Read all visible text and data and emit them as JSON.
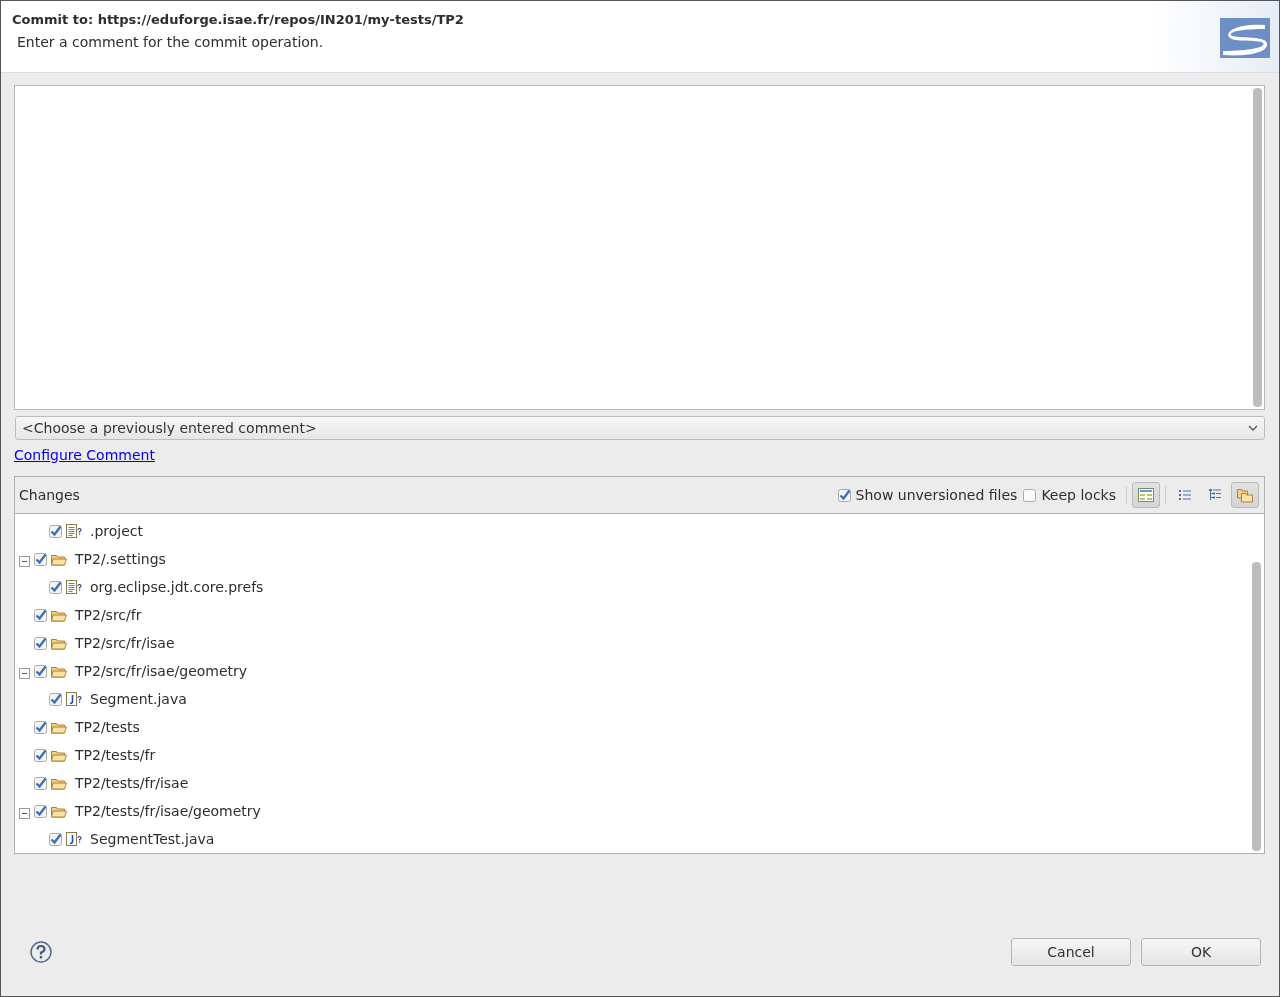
{
  "header": {
    "title": "Commit to: https://eduforge.isae.fr/repos/IN201/my-tests/TP2",
    "message": "Enter a comment for the commit operation."
  },
  "previous_comments": {
    "placeholder": "<Choose a previously entered comment>"
  },
  "configure_link": "Configure Comment",
  "changes": {
    "title": "Changes",
    "options": [
      {
        "label": "Show unversioned files",
        "checked": true
      },
      {
        "label": "Keep locks",
        "checked": false
      }
    ],
    "toolbar": [
      {
        "kind": "layout",
        "selected": true
      },
      {
        "kind": "flat",
        "selected": false
      },
      {
        "kind": "tree",
        "selected": false
      },
      {
        "kind": "compressed",
        "selected": true
      }
    ],
    "scrolled_parent_children": [
      {
        "name": ".project",
        "kind": "text",
        "checked": true
      }
    ],
    "items": [
      {
        "name": "TP2/.settings",
        "kind": "folder",
        "checked": true,
        "expanded": true,
        "children": [
          {
            "name": "org.eclipse.jdt.core.prefs",
            "kind": "text",
            "checked": true
          }
        ]
      },
      {
        "name": "TP2/src/fr",
        "kind": "folder",
        "checked": true
      },
      {
        "name": "TP2/src/fr/isae",
        "kind": "folder",
        "checked": true
      },
      {
        "name": "TP2/src/fr/isae/geometry",
        "kind": "folder",
        "checked": true,
        "expanded": true,
        "children": [
          {
            "name": "Segment.java",
            "kind": "java",
            "checked": true
          }
        ]
      },
      {
        "name": "TP2/tests",
        "kind": "folder",
        "checked": true
      },
      {
        "name": "TP2/tests/fr",
        "kind": "folder",
        "checked": true
      },
      {
        "name": "TP2/tests/fr/isae",
        "kind": "folder",
        "checked": true
      },
      {
        "name": "TP2/tests/fr/isae/geometry",
        "kind": "folder",
        "checked": true,
        "expanded": true,
        "children": [
          {
            "name": "SegmentTest.java",
            "kind": "java",
            "checked": true
          }
        ]
      }
    ]
  },
  "buttons": [
    "Cancel",
    "OK"
  ]
}
